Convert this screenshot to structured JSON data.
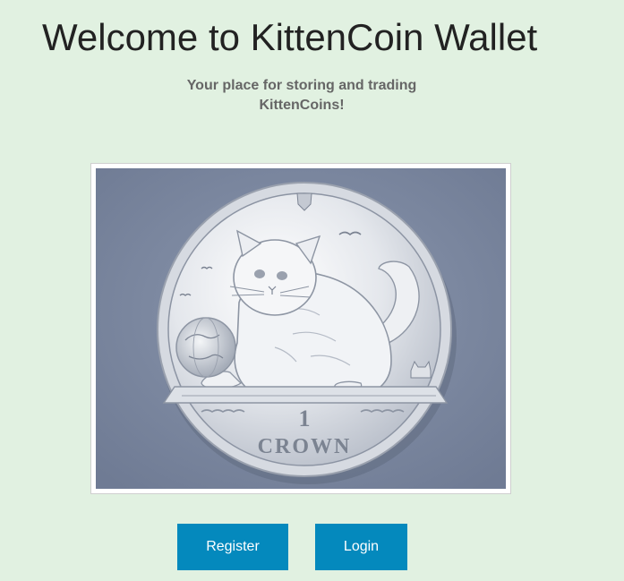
{
  "header": {
    "title": "Welcome to KittenCoin Wallet",
    "subtitle": "Your place for storing and trading KittenCoins!"
  },
  "hero": {
    "coin_denomination": "1",
    "coin_label": "CROWN"
  },
  "actions": {
    "register_label": "Register",
    "login_label": "Login"
  },
  "colors": {
    "page_background": "#e1f1e1",
    "button_background": "#0489bd",
    "button_text": "#ffffff",
    "title_text": "#222222",
    "subtitle_text": "#666666"
  }
}
